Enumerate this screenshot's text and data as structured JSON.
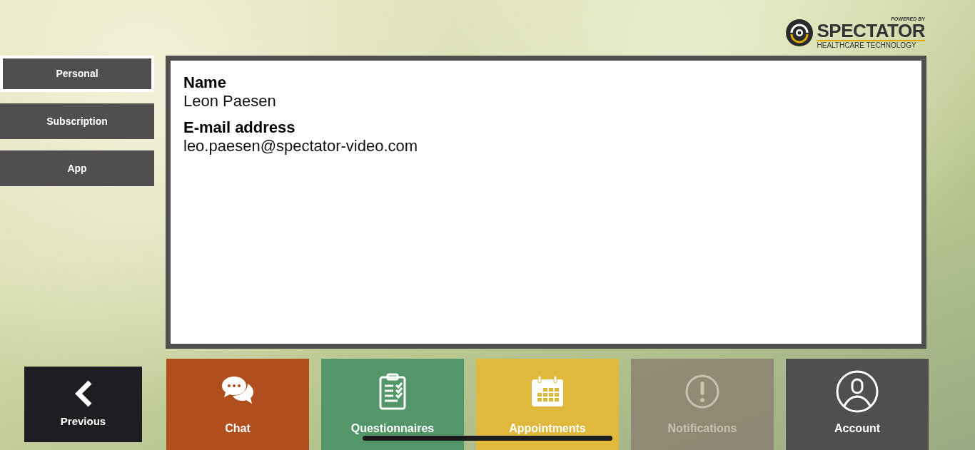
{
  "logo": {
    "tagline": "POWERED BY",
    "brand": "SPECTATOR",
    "subtitle": "HEALTHCARE TECHNOLOGY"
  },
  "tabs": [
    {
      "label": "Personal",
      "selected": true
    },
    {
      "label": "Subscription",
      "selected": false
    },
    {
      "label": "App",
      "selected": false
    }
  ],
  "fields": [
    {
      "label": "Name",
      "value": "Leon Paesen"
    },
    {
      "label": "E-mail address",
      "value": "leo.paesen@spectator-video.com"
    }
  ],
  "previous": {
    "label": "Previous"
  },
  "tiles": [
    {
      "kind": "chat",
      "label": "Chat",
      "color": "#b04e1e",
      "disabled": false
    },
    {
      "kind": "questionnaire",
      "label": "Questionnaires",
      "color": "#52966a",
      "disabled": false
    },
    {
      "kind": "calendar",
      "label": "Appointments",
      "color": "#e0b83c",
      "disabled": false
    },
    {
      "kind": "alert",
      "label": "Notifications",
      "color": "#8a7a6e",
      "disabled": true
    },
    {
      "kind": "account",
      "label": "Account",
      "color": "#4e4f4e",
      "disabled": false
    }
  ]
}
